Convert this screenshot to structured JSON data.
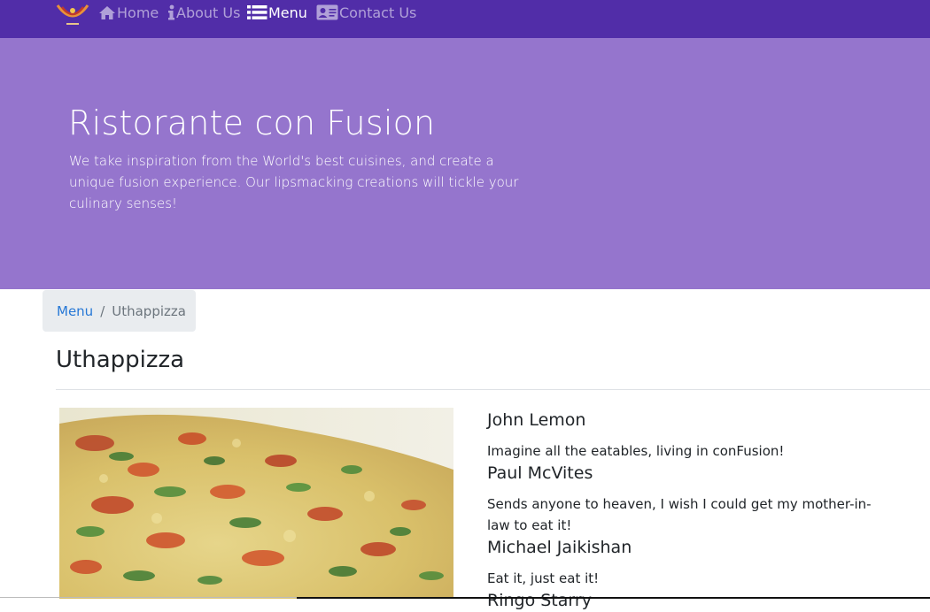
{
  "navbar": {
    "logo_icon": "restaurant-logo",
    "items": [
      {
        "label": "Home",
        "icon": "home-icon",
        "active": false
      },
      {
        "label": "About Us",
        "icon": "info-icon",
        "active": false
      },
      {
        "label": "Menu",
        "icon": "list-icon",
        "active": true
      },
      {
        "label": "Contact Us",
        "icon": "address-card-icon",
        "active": false
      }
    ]
  },
  "jumbotron": {
    "title": "Ristorante con Fusion",
    "text": "We take inspiration from the World's best cuisines, and create a unique fusion experience. Our lipsmacking creations will tickle your culinary senses!"
  },
  "breadcrumb": {
    "link": "Menu",
    "separator": "/",
    "active": "Uthappizza"
  },
  "dish": {
    "title": "Uthappizza"
  },
  "comments": [
    {
      "author": "John Lemon",
      "text": "Imagine all the eatables, living in conFusion!"
    },
    {
      "author": "Paul McVites",
      "text": "Sends anyone to heaven, I wish I could get my mother-in-law to eat it!"
    },
    {
      "author": "Michael Jaikishan",
      "text": "Eat it, just eat it!"
    },
    {
      "author": "Ringo Starry",
      "text": ""
    }
  ],
  "colors": {
    "navbar": "#512da8",
    "jumbotron": "#9575cd",
    "link": "#2778d6"
  }
}
